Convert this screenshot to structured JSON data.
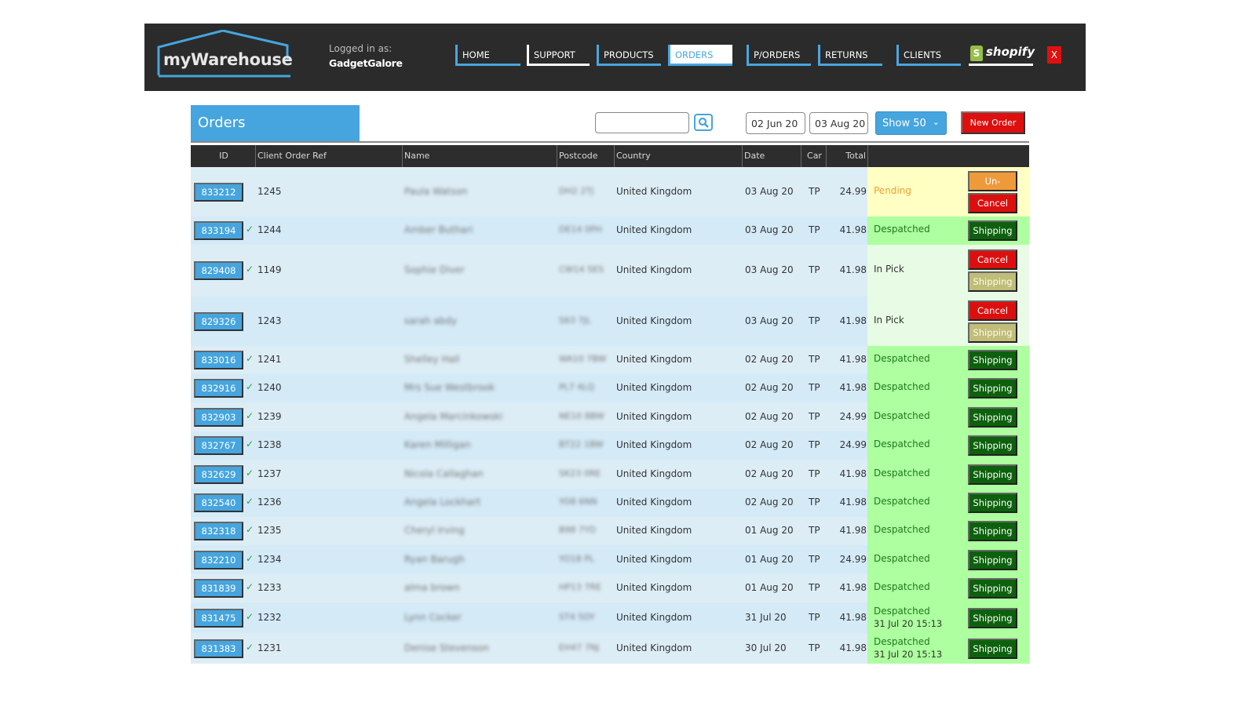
{
  "header": {
    "logo_text": "myWarehouse",
    "logged_in_label": "Logged in as:",
    "logged_in_user": "GadgetGalore",
    "nav": [
      {
        "label": "HOME",
        "active": false
      },
      {
        "label": "SUPPORT",
        "active": false
      },
      {
        "label": "PRODUCTS",
        "active": false
      },
      {
        "label": "ORDERS",
        "active": true
      },
      {
        "label": "P/ORDERS",
        "active": false
      },
      {
        "label": "RETURNS",
        "active": false
      },
      {
        "label": "CLIENTS",
        "active": false
      }
    ],
    "shopify_label": "shopify",
    "shopify_bag_glyph": "S",
    "close_label": "X"
  },
  "toolbar": {
    "page_title": "Orders",
    "search_value": "",
    "search_placeholder": "",
    "search_icon": "search-icon",
    "date_from": "02 Jun 20",
    "date_to": "03 Aug 20",
    "show_select": "Show 50",
    "new_order_label": "New Order"
  },
  "colors": {
    "accent_blue": "#46a5de",
    "danger_red": "#dc0f0f",
    "pending_orange": "#f0a030",
    "despatched_green": "#1f7a1f",
    "shipping_dark_green": "#0d610d"
  },
  "table": {
    "columns": [
      "ID",
      "Client Order Ref",
      "Name",
      "Postcode",
      "Country",
      "Date",
      "Car",
      "Total",
      ""
    ],
    "rows": [
      {
        "id": "833212",
        "checked": false,
        "ref": "1245",
        "name": "Paula Watson",
        "postcode": "DH2 2TJ",
        "country": "United Kingdom",
        "date": "03 Aug 20",
        "car": "TP",
        "total": "24.99",
        "status": "Pending",
        "status_type": "pending",
        "status_sub": "",
        "actions": [
          "Un-Submit",
          "Cancel"
        ]
      },
      {
        "id": "833194",
        "checked": true,
        "ref": "1244",
        "name": "Amber Buthari",
        "postcode": "DE14 0PH",
        "country": "United Kingdom",
        "date": "03 Aug 20",
        "car": "TP",
        "total": "41.98",
        "status": "Despatched",
        "status_type": "despatched",
        "status_sub": "",
        "actions": [
          "Shipping"
        ]
      },
      {
        "id": "829408",
        "checked": true,
        "ref": "1149",
        "name": "Sophie Diver",
        "postcode": "CW14 5ES",
        "country": "United Kingdom",
        "date": "03 Aug 20",
        "car": "TP",
        "total": "41.98",
        "status": "In Pick",
        "status_type": "inpick",
        "status_sub": "",
        "actions": [
          "Cancel",
          "Shipping"
        ]
      },
      {
        "id": "829326",
        "checked": false,
        "ref": "1243",
        "name": "sarah abdy",
        "postcode": "S63 7JL",
        "country": "United Kingdom",
        "date": "03 Aug 20",
        "car": "TP",
        "total": "41.98",
        "status": "In Pick",
        "status_type": "inpick",
        "status_sub": "",
        "actions": [
          "Cancel",
          "Shipping"
        ]
      },
      {
        "id": "833016",
        "checked": true,
        "ref": "1241",
        "name": "Shelley Hall",
        "postcode": "WA10 7BW",
        "country": "United Kingdom",
        "date": "02 Aug 20",
        "car": "TP",
        "total": "41.98",
        "status": "Despatched",
        "status_type": "despatched",
        "status_sub": "",
        "actions": [
          "Shipping"
        ]
      },
      {
        "id": "832916",
        "checked": true,
        "ref": "1240",
        "name": "Mrs Sue Westbrook",
        "postcode": "PL7 4LQ",
        "country": "United Kingdom",
        "date": "02 Aug 20",
        "car": "TP",
        "total": "41.98",
        "status": "Despatched",
        "status_type": "despatched",
        "status_sub": "",
        "actions": [
          "Shipping"
        ]
      },
      {
        "id": "832903",
        "checked": true,
        "ref": "1239",
        "name": "Angela Marcinkowski",
        "postcode": "NE10 8BW",
        "country": "United Kingdom",
        "date": "02 Aug 20",
        "car": "TP",
        "total": "24.99",
        "status": "Despatched",
        "status_type": "despatched",
        "status_sub": "",
        "actions": [
          "Shipping"
        ]
      },
      {
        "id": "832767",
        "checked": true,
        "ref": "1238",
        "name": "Karen Milligan",
        "postcode": "BT22 1BW",
        "country": "United Kingdom",
        "date": "02 Aug 20",
        "car": "TP",
        "total": "24.99",
        "status": "Despatched",
        "status_type": "despatched",
        "status_sub": "",
        "actions": [
          "Shipping"
        ]
      },
      {
        "id": "832629",
        "checked": true,
        "ref": "1237",
        "name": "Nicola Callaghan",
        "postcode": "SK23 0RE",
        "country": "United Kingdom",
        "date": "02 Aug 20",
        "car": "TP",
        "total": "41.98",
        "status": "Despatched",
        "status_type": "despatched",
        "status_sub": "",
        "actions": [
          "Shipping"
        ]
      },
      {
        "id": "832540",
        "checked": true,
        "ref": "1236",
        "name": "Angela Lockhart",
        "postcode": "YO8 6NN",
        "country": "United Kingdom",
        "date": "02 Aug 20",
        "car": "TP",
        "total": "41.98",
        "status": "Despatched",
        "status_type": "despatched",
        "status_sub": "",
        "actions": [
          "Shipping"
        ]
      },
      {
        "id": "832318",
        "checked": true,
        "ref": "1235",
        "name": "Cheryl Irving",
        "postcode": "B98 7YD",
        "country": "United Kingdom",
        "date": "01 Aug 20",
        "car": "TP",
        "total": "41.98",
        "status": "Despatched",
        "status_type": "despatched",
        "status_sub": "",
        "actions": [
          "Shipping"
        ]
      },
      {
        "id": "832210",
        "checked": true,
        "ref": "1234",
        "name": "Ryan Barugh",
        "postcode": "YO18 PL",
        "country": "United Kingdom",
        "date": "01 Aug 20",
        "car": "TP",
        "total": "24.99",
        "status": "Despatched",
        "status_type": "despatched",
        "status_sub": "",
        "actions": [
          "Shipping"
        ]
      },
      {
        "id": "831839",
        "checked": true,
        "ref": "1233",
        "name": "alma brown",
        "postcode": "HP13 7RE",
        "country": "United Kingdom",
        "date": "01 Aug 20",
        "car": "TP",
        "total": "41.98",
        "status": "Despatched",
        "status_type": "despatched",
        "status_sub": "",
        "actions": [
          "Shipping"
        ]
      },
      {
        "id": "831475",
        "checked": true,
        "ref": "1232",
        "name": "Lynn Cocker",
        "postcode": "ST4 5DY",
        "country": "United Kingdom",
        "date": "31 Jul 20",
        "car": "TP",
        "total": "41.98",
        "status": "Despatched",
        "status_type": "despatched",
        "status_sub": "31 Jul 20 15:13",
        "actions": [
          "Shipping"
        ]
      },
      {
        "id": "831383",
        "checked": true,
        "ref": "1231",
        "name": "Denise Stevenson",
        "postcode": "EH47 7NJ",
        "country": "United Kingdom",
        "date": "30 Jul 20",
        "car": "TP",
        "total": "41.98",
        "status": "Despatched",
        "status_type": "despatched",
        "status_sub": "31 Jul 20 15:13",
        "actions": [
          "Shipping"
        ]
      }
    ]
  }
}
